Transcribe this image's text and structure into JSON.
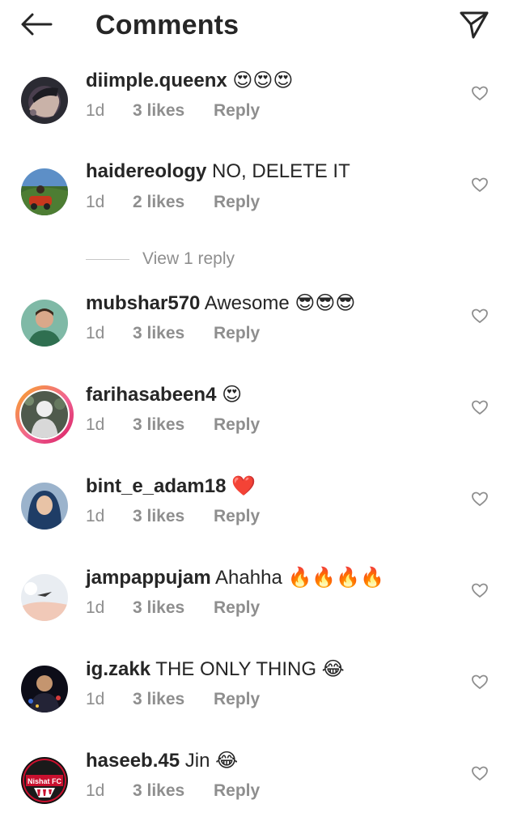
{
  "header": {
    "title": "Comments",
    "back_icon": "arrow-left-icon",
    "send_icon": "paper-plane-icon"
  },
  "comments": [
    {
      "username": "diimple.queenx",
      "text": "😍😍😍",
      "time": "1d",
      "likes": "3 likes",
      "reply": "Reply"
    },
    {
      "username": "haidereology",
      "text": "NO, DELETE IT",
      "time": "1d",
      "likes": "2 likes",
      "reply": "Reply",
      "view_replies": "View 1 reply"
    },
    {
      "username": "mubshar570",
      "text": "Awesome 😎😎😎",
      "time": "1d",
      "likes": "3 likes",
      "reply": "Reply"
    },
    {
      "username": "farihasabeen4",
      "text": "😍",
      "time": "1d",
      "likes": "3 likes",
      "reply": "Reply"
    },
    {
      "username": "bint_e_adam18",
      "text": "❤️",
      "time": "1d",
      "likes": "3 likes",
      "reply": "Reply"
    },
    {
      "username": "jampappujam",
      "text": "Ahahha 🔥🔥🔥🔥",
      "time": "1d",
      "likes": "3 likes",
      "reply": "Reply"
    },
    {
      "username": "ig.zakk",
      "text": "THE ONLY THING 😂",
      "time": "1d",
      "likes": "3 likes",
      "reply": "Reply"
    },
    {
      "username": "haseeb.45",
      "text": "Jin 😂",
      "time": "1d",
      "likes": "3 likes",
      "reply": "Reply"
    }
  ],
  "avatars": {
    "8_badge_text": "Nishat FC"
  },
  "colors": {
    "text": "#262626",
    "secondary": "#8e8e8e",
    "story_ring_start": "#f9a825",
    "story_ring_end": "#d81b60"
  }
}
